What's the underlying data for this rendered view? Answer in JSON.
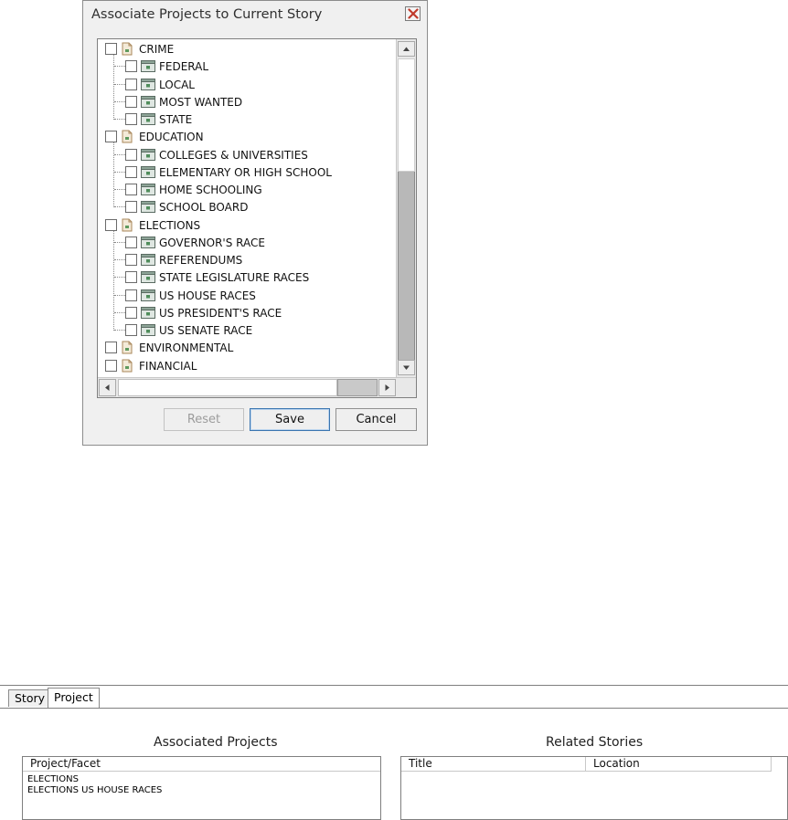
{
  "dialog": {
    "title": "Associate Projects to Current Story",
    "close_glyph": "✕",
    "tree": [
      {
        "label": "CRIME",
        "level": 0
      },
      {
        "label": "FEDERAL",
        "level": 1
      },
      {
        "label": "LOCAL",
        "level": 1
      },
      {
        "label": "MOST WANTED",
        "level": 1
      },
      {
        "label": "STATE",
        "level": 1
      },
      {
        "label": "EDUCATION",
        "level": 0
      },
      {
        "label": "COLLEGES & UNIVERSITIES",
        "level": 1
      },
      {
        "label": "ELEMENTARY OR HIGH SCHOOL",
        "level": 1
      },
      {
        "label": "HOME SCHOOLING",
        "level": 1
      },
      {
        "label": "SCHOOL BOARD",
        "level": 1
      },
      {
        "label": "ELECTIONS",
        "level": 0
      },
      {
        "label": "GOVERNOR'S RACE",
        "level": 1
      },
      {
        "label": "REFERENDUMS",
        "level": 1
      },
      {
        "label": "STATE LEGISLATURE RACES",
        "level": 1
      },
      {
        "label": "US HOUSE RACES",
        "level": 1
      },
      {
        "label": "US PRESIDENT'S RACE",
        "level": 1
      },
      {
        "label": "US SENATE RACE",
        "level": 1
      },
      {
        "label": "ENVIRONMENTAL",
        "level": 0
      },
      {
        "label": "FINANCIAL",
        "level": 0
      }
    ],
    "buttons": {
      "reset": "Reset",
      "save": "Save",
      "cancel": "Cancel"
    }
  },
  "panel": {
    "tabs": [
      "Story",
      "Project"
    ],
    "active_tab": "Project",
    "associated_title": "Associated Projects",
    "related_title": "Related Stories",
    "associated_columns": [
      "Project/Facet"
    ],
    "associated_rows": [
      "ELECTIONS",
      "ELECTIONS US HOUSE RACES"
    ],
    "related_columns": [
      "Title",
      "Location"
    ]
  },
  "colors": {
    "folder_icon": "#c8a97a",
    "item_icon": "#6b8f7a",
    "close_x": "#c0392b",
    "default_button_border": "#3a75b0"
  }
}
